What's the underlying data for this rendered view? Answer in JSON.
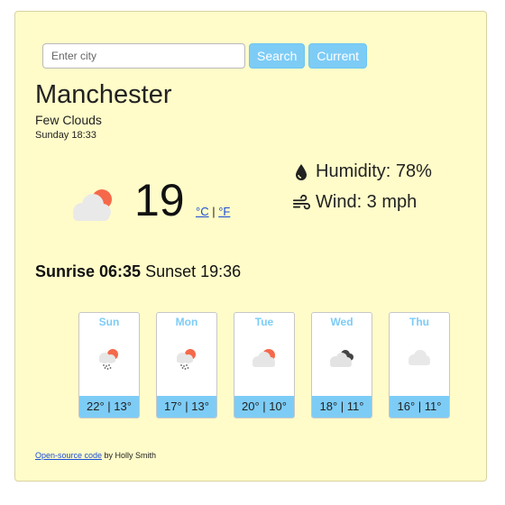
{
  "search": {
    "placeholder": "Enter city",
    "search_label": "Search",
    "current_label": "Current"
  },
  "weather": {
    "city": "Manchester",
    "description": "Few Clouds",
    "datetime": "Sunday 18:33",
    "temperature": "19",
    "unit_c": "°C",
    "unit_sep": "|",
    "unit_f": "°F",
    "icon": "cloud-sun-icon",
    "humidity_text": "Humidity: 78%",
    "wind_text": "Wind: 3 mph",
    "sunrise_text": "Sunrise 06:35",
    "sunset_text": "Sunset 19:36"
  },
  "forecast": [
    {
      "day": "Sun",
      "range": "22° | 13°",
      "icon": "rain-cloud-sun-icon"
    },
    {
      "day": "Mon",
      "range": "17° | 13°",
      "icon": "rain-cloud-sun-icon"
    },
    {
      "day": "Tue",
      "range": "20° | 10°",
      "icon": "cloud-sun-icon"
    },
    {
      "day": "Wed",
      "range": "18° | 11°",
      "icon": "broken-clouds-icon"
    },
    {
      "day": "Thu",
      "range": "16° | 11°",
      "icon": "cloud-icon"
    }
  ],
  "footer": {
    "link_text": "Open-source code",
    "suffix": " by Holly Smith"
  },
  "colors": {
    "accent": "#7dccf6",
    "card_bg": "#fffcc9",
    "sun": "#f5694a"
  }
}
